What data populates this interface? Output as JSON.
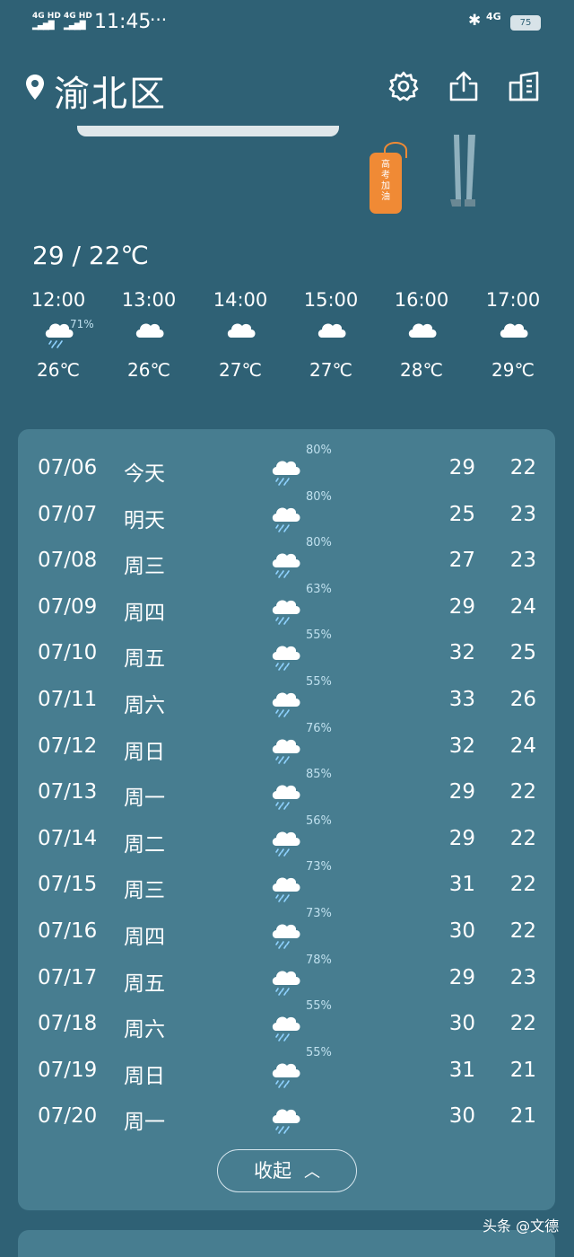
{
  "status_bar": {
    "signal_1": "4G HD",
    "signal_2": "4G HD",
    "time": "11:45",
    "more": "···",
    "network": "4G",
    "battery": "75"
  },
  "header": {
    "city": "渝北区",
    "icons": [
      "location-pin-icon",
      "gear-icon",
      "share-icon",
      "city-list-icon"
    ]
  },
  "illustration": {
    "tag_text": "高考加油"
  },
  "today_range": "29 / 22℃",
  "hourly": [
    {
      "time": "12:00",
      "icon": "rain-icon",
      "prob": "71%",
      "temp": "26℃"
    },
    {
      "time": "13:00",
      "icon": "cloud-icon",
      "prob": "",
      "temp": "26℃"
    },
    {
      "time": "14:00",
      "icon": "cloud-icon",
      "prob": "",
      "temp": "27℃"
    },
    {
      "time": "15:00",
      "icon": "cloud-icon",
      "prob": "",
      "temp": "27℃"
    },
    {
      "time": "16:00",
      "icon": "cloud-icon",
      "prob": "",
      "temp": "28℃"
    },
    {
      "time": "17:00",
      "icon": "cloud-icon",
      "prob": "",
      "temp": "29℃"
    }
  ],
  "daily": [
    {
      "date": "07/06",
      "weekday": "今天",
      "prob": "80%",
      "high": "29",
      "low": "22"
    },
    {
      "date": "07/07",
      "weekday": "明天",
      "prob": "80%",
      "high": "25",
      "low": "23"
    },
    {
      "date": "07/08",
      "weekday": "周三",
      "prob": "80%",
      "high": "27",
      "low": "23"
    },
    {
      "date": "07/09",
      "weekday": "周四",
      "prob": "63%",
      "high": "29",
      "low": "24"
    },
    {
      "date": "07/10",
      "weekday": "周五",
      "prob": "55%",
      "high": "32",
      "low": "25"
    },
    {
      "date": "07/11",
      "weekday": "周六",
      "prob": "55%",
      "high": "33",
      "low": "26"
    },
    {
      "date": "07/12",
      "weekday": "周日",
      "prob": "76%",
      "high": "32",
      "low": "24"
    },
    {
      "date": "07/13",
      "weekday": "周一",
      "prob": "85%",
      "high": "29",
      "low": "22"
    },
    {
      "date": "07/14",
      "weekday": "周二",
      "prob": "56%",
      "high": "29",
      "low": "22"
    },
    {
      "date": "07/15",
      "weekday": "周三",
      "prob": "73%",
      "high": "31",
      "low": "22"
    },
    {
      "date": "07/16",
      "weekday": "周四",
      "prob": "73%",
      "high": "30",
      "low": "22"
    },
    {
      "date": "07/17",
      "weekday": "周五",
      "prob": "78%",
      "high": "29",
      "low": "23"
    },
    {
      "date": "07/18",
      "weekday": "周六",
      "prob": "55%",
      "high": "30",
      "low": "22"
    },
    {
      "date": "07/19",
      "weekday": "周日",
      "prob": "55%",
      "high": "31",
      "low": "21"
    },
    {
      "date": "07/20",
      "weekday": "周一",
      "prob": "",
      "high": "30",
      "low": "21"
    }
  ],
  "collapse_label": "收起",
  "watermark": "头条 @文德",
  "colors": {
    "background": "#2f6175",
    "card": "#477d90",
    "tag": "#f08a35",
    "precip_text": "#bfe0ee"
  }
}
